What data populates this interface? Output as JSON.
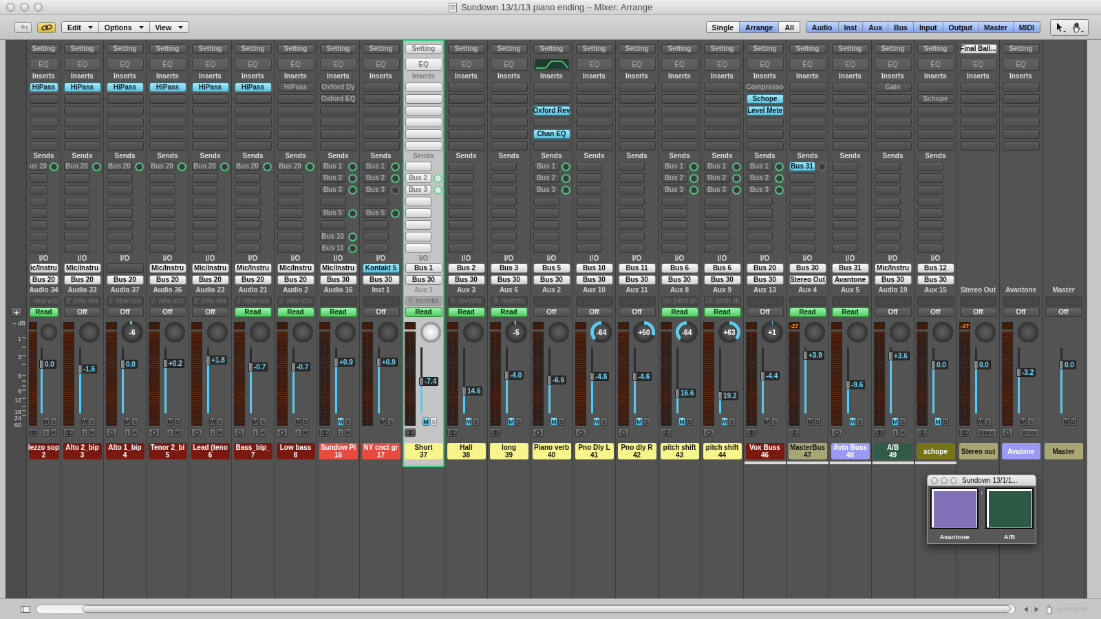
{
  "window": {
    "title": "Sundown 13/1/13 piano ending – Mixer: Arrange"
  },
  "toolbar": {
    "link": {
      "on": true
    },
    "menus": [
      "Edit",
      "Options",
      "View"
    ],
    "views": [
      {
        "label": "Single",
        "selected": false
      },
      {
        "label": "Arrange",
        "selected": true
      },
      {
        "label": "All",
        "selected": false
      }
    ],
    "filters": [
      {
        "label": "Audio",
        "selected": true
      },
      {
        "label": "Inst",
        "selected": true
      },
      {
        "label": "Aux",
        "selected": true
      },
      {
        "label": "Bus",
        "selected": true
      },
      {
        "label": "Input",
        "selected": true
      },
      {
        "label": "Output",
        "selected": true
      },
      {
        "label": "Master",
        "selected": true
      },
      {
        "label": "MIDI",
        "selected": true
      }
    ]
  },
  "scale": {
    "add_button": "+",
    "label": "– dB",
    "ticks": [
      "1",
      "3",
      "6",
      "9",
      "12",
      "18",
      "24",
      "60"
    ]
  },
  "strips": [
    {
      "kind": "channel",
      "selected": false,
      "setting": {
        "label": "Setting",
        "loaded": false
      },
      "eq": "EQ",
      "inserts_label": "Inserts",
      "inserts": [
        {
          "kind": "plugin",
          "label": "HiPass",
          "on": true
        }
      ],
      "sends_label": "Sends",
      "sends": [
        {
          "kind": "bus",
          "label": "us 20",
          "on": false,
          "active": true
        }
      ],
      "io_label": "I/O",
      "input": {
        "kind": "port",
        "label": "ic/Instru"
      },
      "output": "Bus 20",
      "track": "Audio 34",
      "group": ": new vox",
      "automation": {
        "label": "Read",
        "on": true
      },
      "meter": {
        "kind": "mono"
      },
      "fader": {
        "value": "0.0",
        "level": 0.75
      },
      "mute": {
        "label": "M",
        "on": false
      },
      "solo": {
        "label": "S"
      },
      "format": {
        "kind": "stereo"
      },
      "io_buttons": [
        "I",
        "R"
      ],
      "name": "lezzo sop",
      "number": "2",
      "color": "#7a1912",
      "underlined": false
    },
    {
      "kind": "channel",
      "selected": false,
      "setting": {
        "label": "Setting",
        "loaded": false
      },
      "eq": "EQ",
      "inserts_label": "Inserts",
      "inserts": [
        {
          "kind": "plugin",
          "label": "HiPass",
          "on": true
        }
      ],
      "sends_label": "Sends",
      "sends": [
        {
          "kind": "bus",
          "label": "Bus 20",
          "on": false,
          "active": true
        }
      ],
      "io_label": "I/O",
      "input": {
        "kind": "port",
        "label": "Mic/Instru"
      },
      "output": "Bus 20",
      "track": "Audio 33",
      "group": "2: new vox",
      "automation": {
        "label": "Off",
        "on": false
      },
      "meter": {
        "kind": "mono"
      },
      "fader": {
        "value": "-1.6",
        "level": 0.68
      },
      "mute": {
        "label": "M",
        "on": false
      },
      "solo": {
        "label": "S"
      },
      "format": {
        "kind": "stereo"
      },
      "io_buttons": [
        "I",
        "R"
      ],
      "name": "Alto 2_bip",
      "number": "3",
      "color": "#7a1912",
      "underlined": false
    },
    {
      "kind": "channel",
      "selected": false,
      "setting": {
        "label": "Setting",
        "loaded": false
      },
      "eq": "EQ",
      "inserts_label": "Inserts",
      "inserts": [
        {
          "kind": "plugin",
          "label": "HiPass",
          "on": true
        }
      ],
      "sends_label": "Sends",
      "sends": [
        {
          "kind": "bus",
          "label": "Bus 20",
          "on": false,
          "active": true
        }
      ],
      "io_label": "I/O",
      "input": {
        "kind": "empty"
      },
      "output": "Bus 20",
      "track": "Audio 37",
      "group": "2: new vox",
      "automation": {
        "label": "Off",
        "on": false
      },
      "pan": "-6",
      "meter": {
        "kind": "mono"
      },
      "fader": {
        "value": "0.0",
        "level": 0.75
      },
      "mute": {
        "label": "M",
        "on": false
      },
      "solo": {
        "label": "S"
      },
      "format": {
        "kind": "mono"
      },
      "io_buttons": [
        "I",
        "R"
      ],
      "name": "Alto 1_bip",
      "number": "4",
      "color": "#7a1912",
      "underlined": false
    },
    {
      "kind": "channel",
      "selected": false,
      "setting": {
        "label": "Setting",
        "loaded": false
      },
      "eq": "EQ",
      "inserts_label": "Inserts",
      "inserts": [
        {
          "kind": "plugin",
          "label": "HiPass",
          "on": true
        }
      ],
      "sends_label": "Sends",
      "sends": [
        {
          "kind": "bus",
          "label": "Bus 20",
          "on": false,
          "active": true
        }
      ],
      "io_label": "I/O",
      "input": {
        "kind": "port",
        "label": "Mic/Instru"
      },
      "output": "Bus 20",
      "track": "Audio 36",
      "group": "2: new vox",
      "automation": {
        "label": "Off",
        "on": false
      },
      "meter": {
        "kind": "mono"
      },
      "fader": {
        "value": "+0.2",
        "level": 0.76
      },
      "mute": {
        "label": "M",
        "on": false
      },
      "solo": {
        "label": "S"
      },
      "format": {
        "kind": "mono"
      },
      "io_buttons": [
        "I",
        "R"
      ],
      "name": "Tenor 2_bi",
      "number": "5",
      "color": "#7a1912",
      "underlined": false
    },
    {
      "kind": "channel",
      "selected": false,
      "setting": {
        "label": "Setting",
        "loaded": false
      },
      "eq": "EQ",
      "inserts_label": "Inserts",
      "inserts": [
        {
          "kind": "plugin",
          "label": "HiPass",
          "on": true
        }
      ],
      "sends_label": "Sends",
      "sends": [
        {
          "kind": "bus",
          "label": "Bus 20",
          "on": false,
          "active": true
        }
      ],
      "io_label": "I/O",
      "input": {
        "kind": "port",
        "label": "Mic/Instru"
      },
      "output": "Bus 20",
      "track": "Audio 23",
      "group": "2: new vox",
      "automation": {
        "label": "Off",
        "on": false
      },
      "meter": {
        "kind": "mono"
      },
      "fader": {
        "value": "+1.8",
        "level": 0.81
      },
      "mute": {
        "label": "M",
        "on": false
      },
      "solo": {
        "label": "S"
      },
      "format": {
        "kind": "mono"
      },
      "io_buttons": [
        "I",
        "R"
      ],
      "name": "Lead (teno",
      "number": "6",
      "color": "#7a1912",
      "underlined": false
    },
    {
      "kind": "channel",
      "selected": false,
      "setting": {
        "label": "Setting",
        "loaded": false
      },
      "eq": "EQ",
      "inserts_label": "Inserts",
      "inserts": [
        {
          "kind": "plugin",
          "label": "HiPass",
          "on": true
        }
      ],
      "sends_label": "Sends",
      "sends": [
        {
          "kind": "bus",
          "label": "Bus 20",
          "on": false,
          "active": true
        }
      ],
      "io_label": "I/O",
      "input": {
        "kind": "port",
        "label": "Mic/Instru"
      },
      "output": "Bus 20",
      "track": "Audio 21",
      "group": "2: new vox",
      "automation": {
        "label": "Read",
        "on": true
      },
      "meter": {
        "kind": "mono"
      },
      "fader": {
        "value": "-0.7",
        "level": 0.71
      },
      "mute": {
        "label": "M",
        "on": false
      },
      "solo": {
        "label": "S"
      },
      "format": {
        "kind": "mono"
      },
      "io_buttons": [
        "I",
        "R"
      ],
      "name": "Bass_bip_",
      "number": "7",
      "color": "#7a1912",
      "underlined": false
    },
    {
      "kind": "channel",
      "selected": false,
      "setting": {
        "label": "Setting",
        "loaded": false
      },
      "eq": "EQ",
      "inserts_label": "Inserts",
      "inserts": [
        {
          "kind": "plugin",
          "label": "HiPass",
          "on": false
        }
      ],
      "sends_label": "Sends",
      "sends": [
        {
          "kind": "bus",
          "label": "Bus 20",
          "on": false,
          "active": true
        }
      ],
      "io_label": "I/O",
      "input": {
        "kind": "port",
        "label": "Mic/Instru"
      },
      "output": "Bus 20",
      "track": "Audio 2",
      "group": "2: new vox",
      "automation": {
        "label": "Read",
        "on": true
      },
      "meter": {
        "kind": "mono"
      },
      "fader": {
        "value": "-0.7",
        "level": 0.71
      },
      "mute": {
        "label": "M",
        "on": false
      },
      "solo": {
        "label": "S"
      },
      "format": {
        "kind": "mono"
      },
      "io_buttons": [
        "I",
        "R"
      ],
      "name": "Low bass",
      "number": "8",
      "color": "#7a1912",
      "underlined": false
    },
    {
      "kind": "channel",
      "selected": false,
      "setting": {
        "label": "Setting",
        "loaded": false
      },
      "eq": "EQ",
      "inserts_label": "Inserts",
      "inserts": [
        {
          "kind": "plugin",
          "label": "Oxford Dy",
          "on": false
        },
        {
          "kind": "plugin",
          "label": "Oxford EQ",
          "on": false
        }
      ],
      "sends_label": "Sends",
      "sends": [
        {
          "kind": "bus",
          "label": "Bus 1",
          "on": false,
          "active": true
        },
        {
          "kind": "bus",
          "label": "Bus 2",
          "on": false,
          "active": true
        },
        {
          "kind": "bus",
          "label": "Bus 3",
          "on": false,
          "active": true
        },
        {
          "kind": "empty"
        },
        {
          "kind": "bus",
          "label": "Bus 5",
          "on": false,
          "active": true
        },
        {
          "kind": "empty"
        },
        {
          "kind": "bus",
          "label": "Bus 10",
          "on": false,
          "active": true
        },
        {
          "kind": "bus",
          "label": "Bus 11",
          "on": false,
          "active": true
        }
      ],
      "io_label": "I/O",
      "input": {
        "kind": "port",
        "label": "Mic/Instru"
      },
      "output": "Bus 30",
      "track": "Audio 16",
      "automation": {
        "label": "Read",
        "on": true
      },
      "meter": {
        "kind": "stereo"
      },
      "fader": {
        "value": "+0.9",
        "level": 0.78
      },
      "mute": {
        "label": "M",
        "on": true
      },
      "solo": {
        "label": "S"
      },
      "format": {
        "kind": "stereo"
      },
      "io_buttons": [
        "I",
        "R"
      ],
      "name": "Sundow Pi",
      "number": "16",
      "color": "#e84a3f",
      "underlined": false
    },
    {
      "kind": "channel",
      "selected": false,
      "setting": {
        "label": "Setting",
        "loaded": false
      },
      "eq": "EQ",
      "inserts_label": "Inserts",
      "sends_label": "Sends",
      "sends": [
        {
          "kind": "bus",
          "label": "Bus 1",
          "on": false,
          "active": true
        },
        {
          "kind": "bus",
          "label": "Bus 2",
          "on": false,
          "active": true
        },
        {
          "kind": "bus",
          "label": "Bus 3",
          "on": false,
          "active": false
        },
        {
          "kind": "empty"
        },
        {
          "kind": "bus",
          "label": "Bus 5",
          "on": false,
          "active": true
        }
      ],
      "io_label": "I/O",
      "input": {
        "kind": "plugin",
        "label": "Kontakt 5"
      },
      "output": "Bus 30",
      "track": "Inst 1",
      "automation": {
        "label": "Off",
        "on": false
      },
      "meter": {
        "kind": "stereo"
      },
      "fader": {
        "value": "+0.9",
        "level": 0.78
      },
      "mute": {
        "label": "M",
        "on": false
      },
      "solo": {
        "label": "S"
      },
      "name": "NY cnct gr",
      "number": "17",
      "color": "#e84a3f",
      "underlined": false
    },
    {
      "kind": "channel",
      "selected": true,
      "setting": {
        "label": "Setting",
        "loaded": false
      },
      "eq": "EQ",
      "inserts_label": "Inserts",
      "sends_label": "Sends",
      "sends": [
        {
          "kind": "empty"
        },
        {
          "kind": "bus",
          "label": "Bus 2",
          "on": false,
          "active": true
        },
        {
          "kind": "bus",
          "label": "Bus 3",
          "on": false,
          "active": true
        }
      ],
      "io_label": "I/O",
      "input": {
        "kind": "port",
        "label": "Bus 1"
      },
      "output": "Bus 30",
      "track": "Aux 1",
      "group": "9: reverbs",
      "automation": {
        "label": "Read",
        "on": true
      },
      "meter": {
        "kind": "stereo"
      },
      "fader": {
        "value": "-7.4",
        "level": 0.49
      },
      "mute": {
        "label": "M",
        "on": true
      },
      "solo": {
        "label": "S"
      },
      "format": {
        "kind": "stereo"
      },
      "name": "Short",
      "number": "37",
      "color": "#f8f48c",
      "underlined": false
    },
    {
      "kind": "channel",
      "selected": false,
      "setting": {
        "label": "Setting",
        "loaded": false
      },
      "eq": "EQ",
      "inserts_label": "Inserts",
      "sends_label": "Sends",
      "io_label": "I/O",
      "input": {
        "kind": "port",
        "label": "Bus 2"
      },
      "output": "Bus 30",
      "track": "Aux 3",
      "group": "9: reverbs",
      "automation": {
        "label": "Read",
        "on": true
      },
      "meter": {
        "kind": "stereo"
      },
      "fader": {
        "value": "14.6",
        "level": 0.34
      },
      "mute": {
        "label": "M",
        "on": true
      },
      "solo": {
        "label": "S"
      },
      "format": {
        "kind": "stereo"
      },
      "name": "Hall",
      "number": "38",
      "color": "#f8f48c",
      "underlined": false
    },
    {
      "kind": "channel",
      "selected": false,
      "setting": {
        "label": "Setting",
        "loaded": false
      },
      "eq": "EQ",
      "inserts_label": "Inserts",
      "sends_label": "Sends",
      "io_label": "I/O",
      "input": {
        "kind": "port",
        "label": "Bus 3"
      },
      "output": "Bus 30",
      "track": "Aux 6",
      "group": "9: reverbs",
      "automation": {
        "label": "Read",
        "on": true
      },
      "pan": "-5",
      "meter": {
        "kind": "stereo"
      },
      "fader": {
        "value": "-4.0",
        "level": 0.58
      },
      "mute": {
        "label": "M",
        "on": true
      },
      "solo": {
        "label": "S"
      },
      "format": {
        "kind": "stereo"
      },
      "name": "long",
      "number": "39",
      "color": "#f8f48c",
      "underlined": false
    },
    {
      "kind": "channel",
      "selected": false,
      "setting": {
        "label": "Setting",
        "loaded": false
      },
      "eq_curve": true,
      "inserts_label": "Inserts",
      "inserts": [
        {
          "kind": "empty"
        },
        {
          "kind": "empty"
        },
        {
          "kind": "plugin",
          "label": "Oxford Rev",
          "on": true
        },
        {
          "kind": "empty"
        },
        {
          "kind": "plugin",
          "label": "Chan EQ",
          "on": true
        }
      ],
      "sends_label": "Sends",
      "sends": [
        {
          "kind": "bus",
          "label": "Bus 1",
          "on": false,
          "active": true
        },
        {
          "kind": "bus",
          "label": "Bus 2",
          "on": false,
          "active": true
        },
        {
          "kind": "bus",
          "label": "Bus 3",
          "on": false,
          "active": true
        }
      ],
      "io_label": "I/O",
      "input": {
        "kind": "port",
        "label": "Bus 5"
      },
      "output": "Bus 30",
      "track": "Aux 2",
      "automation": {
        "label": "Off",
        "on": false
      },
      "meter": {
        "kind": "stereo"
      },
      "fader": {
        "value": "-6.6",
        "level": 0.51
      },
      "mute": {
        "label": "M",
        "on": true
      },
      "solo": {
        "label": "S"
      },
      "format": {
        "kind": "mono"
      },
      "name": "Piano verb",
      "number": "40",
      "color": "#f8f48c",
      "underlined": false
    },
    {
      "kind": "channel",
      "selected": false,
      "setting": {
        "label": "Setting",
        "loaded": false
      },
      "eq": "EQ",
      "inserts_label": "Inserts",
      "sends_label": "Sends",
      "io_label": "I/O",
      "input": {
        "kind": "port",
        "label": "Bus 10"
      },
      "output": "Bus 30",
      "track": "Aux 10",
      "automation": {
        "label": "Off",
        "on": false
      },
      "pan": "-64",
      "meter": {
        "kind": "mono"
      },
      "fader": {
        "value": "-4.6",
        "level": 0.56
      },
      "mute": {
        "label": "M",
        "on": true
      },
      "solo": {
        "label": "S"
      },
      "format": {
        "kind": "mono"
      },
      "name": "Pno Dly L",
      "number": "41",
      "color": "#f8f48c",
      "underlined": false
    },
    {
      "kind": "channel",
      "selected": false,
      "setting": {
        "label": "Setting",
        "loaded": false
      },
      "eq": "EQ",
      "inserts_label": "Inserts",
      "sends_label": "Sends",
      "io_label": "I/O",
      "input": {
        "kind": "port",
        "label": "Bus 11"
      },
      "output": "Bus 30",
      "track": "Aux 11",
      "automation": {
        "label": "Off",
        "on": false
      },
      "pan": "+50",
      "meter": {
        "kind": "mono"
      },
      "fader": {
        "value": "-4.6",
        "level": 0.56
      },
      "mute": {
        "label": "M",
        "on": true
      },
      "solo": {
        "label": "S"
      },
      "format": {
        "kind": "mono"
      },
      "name": "Pno dly R",
      "number": "42",
      "color": "#f8f48c",
      "underlined": false
    },
    {
      "kind": "channel",
      "selected": false,
      "setting": {
        "label": "Setting",
        "loaded": false
      },
      "eq": "EQ",
      "inserts_label": "Inserts",
      "sends_label": "Sends",
      "sends": [
        {
          "kind": "bus",
          "label": "Bus 1",
          "on": false,
          "active": true
        },
        {
          "kind": "bus",
          "label": "Bus 2",
          "on": false,
          "active": true
        },
        {
          "kind": "bus",
          "label": "Bus 3",
          "on": false,
          "active": true
        }
      ],
      "io_label": "I/O",
      "input": {
        "kind": "port",
        "label": "Bus 6"
      },
      "output": "Bus 30",
      "track": "Aux 8",
      "group": "10: pitch sh",
      "automation": {
        "label": "Read",
        "on": true
      },
      "pan": "-64",
      "meter": {
        "kind": "stereo"
      },
      "fader": {
        "value": "16.6",
        "level": 0.31
      },
      "mute": {
        "label": "M",
        "on": true
      },
      "solo": {
        "label": "S"
      },
      "format": {
        "kind": "stereo"
      },
      "name": "pitch shift",
      "number": "43",
      "color": "#f8f48c",
      "underlined": false
    },
    {
      "kind": "channel",
      "selected": false,
      "setting": {
        "label": "Setting",
        "loaded": false
      },
      "eq": "EQ",
      "inserts_label": "Inserts",
      "sends_label": "Sends",
      "sends": [
        {
          "kind": "bus",
          "label": "Bus 1",
          "on": false,
          "active": true
        },
        {
          "kind": "bus",
          "label": "Bus 2",
          "on": false,
          "active": true
        },
        {
          "kind": "bus",
          "label": "Bus 3",
          "on": false,
          "active": true
        }
      ],
      "io_label": "I/O",
      "input": {
        "kind": "port",
        "label": "Bus 6"
      },
      "output": "Bus 30",
      "track": "Aux 9",
      "group": "10: pitch sh",
      "automation": {
        "label": "Read",
        "on": true
      },
      "pan": "+63",
      "meter": {
        "kind": "mono"
      },
      "fader": {
        "value": "19.2",
        "level": 0.27
      },
      "mute": {
        "label": "M",
        "on": true
      },
      "solo": {
        "label": "S"
      },
      "format": {
        "kind": "mono"
      },
      "name": "pitch shift",
      "number": "44",
      "color": "#f8f48c",
      "underlined": false
    },
    {
      "kind": "channel",
      "selected": false,
      "setting": {
        "label": "Setting",
        "loaded": false
      },
      "eq": "EQ",
      "inserts_label": "Inserts",
      "inserts": [
        {
          "kind": "plugin",
          "label": "Compresso",
          "on": false
        },
        {
          "kind": "plugin",
          "label": "Schope",
          "on": true
        },
        {
          "kind": "plugin",
          "label": "Level Mete",
          "on": true
        }
      ],
      "sends_label": "Sends",
      "sends": [
        {
          "kind": "bus",
          "label": "Bus 1",
          "on": false,
          "active": true
        },
        {
          "kind": "bus",
          "label": "Bus 2",
          "on": false,
          "active": true
        },
        {
          "kind": "bus",
          "label": "Bus 3",
          "on": false,
          "active": true
        }
      ],
      "io_label": "I/O",
      "input": {
        "kind": "port",
        "label": "Bus 20"
      },
      "output": "Bus 30",
      "track": "Aux 13",
      "automation": {
        "label": "Off",
        "on": false
      },
      "pan": "+1",
      "meter": {
        "kind": "stereo"
      },
      "fader": {
        "value": "-4.4",
        "level": 0.57
      },
      "mute": {
        "label": "M",
        "on": false
      },
      "solo": {
        "label": "S"
      },
      "format": {
        "kind": "stereo"
      },
      "name": "Vox Buss",
      "number": "46",
      "color": "#7a1912",
      "underlined": true
    },
    {
      "kind": "channel",
      "selected": false,
      "setting": {
        "label": "Setting",
        "loaded": false
      },
      "eq": "EQ",
      "inserts_label": "Inserts",
      "sends_label": "Sends",
      "sends": [
        {
          "kind": "bus",
          "label": "Bus 31",
          "on": true,
          "active": false
        }
      ],
      "io_label": "I/O",
      "input": {
        "kind": "port",
        "label": "Bus 30"
      },
      "output": "Stereo Out",
      "track": "Aux 4",
      "automation": {
        "label": "Read",
        "on": true
      },
      "peak": "-27",
      "meter": {
        "kind": "stereo"
      },
      "fader": {
        "value": "+3.9",
        "level": 0.89
      },
      "mute": {
        "label": "M",
        "on": false
      },
      "solo": {
        "label": "S"
      },
      "format": {
        "kind": "stereo"
      },
      "name": "MasterBus",
      "number": "47",
      "color": "#a9a676",
      "underlined": true
    },
    {
      "kind": "channel",
      "selected": false,
      "setting": {
        "label": "Setting",
        "loaded": false
      },
      "eq": "EQ",
      "inserts_label": "Inserts",
      "sends_label": "Sends",
      "io_label": "I/O",
      "input": {
        "kind": "port",
        "label": "Bus 31"
      },
      "output": "Avantone",
      "track": "Aux 5",
      "automation": {
        "label": "Read",
        "on": true
      },
      "meter": {
        "kind": "mono"
      },
      "fader": {
        "value": "-9.6",
        "level": 0.44
      },
      "mute": {
        "label": "M",
        "on": true
      },
      "solo": {
        "label": "S"
      },
      "format": {
        "kind": "mono"
      },
      "name": "Avtn Buss",
      "number": "48",
      "color": "#9a9af2",
      "underlined": true
    },
    {
      "kind": "channel",
      "selected": false,
      "setting": {
        "label": "Setting",
        "loaded": false
      },
      "eq": "EQ",
      "inserts_label": "Inserts",
      "inserts": [
        {
          "kind": "plugin",
          "label": "Gain",
          "on": false
        }
      ],
      "sends_label": "Sends",
      "io_label": "I/O",
      "input": {
        "kind": "port",
        "label": "Mic/Instru"
      },
      "output": "Bus 30",
      "track": "Audio 19",
      "automation": {
        "label": "Off",
        "on": false
      },
      "meter": {
        "kind": "stereo"
      },
      "fader": {
        "value": "+3.6",
        "level": 0.88
      },
      "mute": {
        "label": "M",
        "on": true
      },
      "solo": {
        "label": "S"
      },
      "format": {
        "kind": "stereo"
      },
      "io_buttons": [
        "I",
        "R"
      ],
      "name": "A/B",
      "number": "49",
      "color": "#2f5a47",
      "underlined": true
    },
    {
      "kind": "channel",
      "selected": false,
      "setting": {
        "label": "Setting",
        "loaded": false
      },
      "eq": "EQ",
      "inserts_label": "Inserts",
      "inserts": [
        {
          "kind": "empty"
        },
        {
          "kind": "plugin",
          "label": "Schope",
          "on": false
        }
      ],
      "sends_label": "Sends",
      "io_label": "I/O",
      "input": {
        "kind": "port",
        "label": "Bus 12"
      },
      "output": "Bus 30",
      "track": "Aux 15",
      "automation": {
        "label": "Off",
        "on": false
      },
      "meter": {
        "kind": "stereo"
      },
      "fader": {
        "value": "0.0",
        "level": 0.74
      },
      "mute": {
        "label": "M",
        "on": true
      },
      "solo": {
        "label": "S"
      },
      "format": {
        "kind": "stereo"
      },
      "name": "schope",
      "color": "#777318",
      "underlined": true
    },
    {
      "kind": "output",
      "selected": false,
      "setting": {
        "label": "Final Ball...",
        "loaded": true
      },
      "eq": "EQ",
      "inserts_label": "Inserts",
      "track": "Stereo Out",
      "automation": {
        "label": "Off",
        "on": false
      },
      "peak": "-27",
      "meter": {
        "kind": "stereo"
      },
      "fader": {
        "value": "0.0",
        "level": 0.74
      },
      "mute": {
        "label": "M",
        "on": false
      },
      "solo": {
        "label": "S"
      },
      "format": {
        "kind": "stereo"
      },
      "io_buttons": [
        "Bnce"
      ],
      "name": "Stereo out",
      "color": "#a9a676",
      "underlined": false
    },
    {
      "kind": "output",
      "selected": false,
      "setting": {
        "label": "Setting",
        "loaded": false
      },
      "eq": "EQ",
      "inserts_label": "Inserts",
      "track": "Avantone",
      "automation": {
        "label": "Off",
        "on": false
      },
      "meter": {
        "kind": "mono"
      },
      "fader": {
        "value": "-3.2",
        "level": 0.62
      },
      "mute": {
        "label": "M",
        "on": false
      },
      "solo": {
        "label": "S"
      },
      "format": {
        "kind": "mono"
      },
      "io_buttons": [
        "Bnce"
      ],
      "name": "Avatone",
      "color": "#9a9af2",
      "underlined": false
    },
    {
      "kind": "master",
      "selected": false,
      "track": "Master",
      "automation": {
        "label": "Off",
        "on": false
      },
      "fader": {
        "value": "0.0",
        "level": 0.74
      },
      "mute": {
        "label": "M",
        "on": false
      },
      "solo": {
        "label": "D"
      },
      "name": "Master",
      "color": "#a9a676",
      "underlined": false
    }
  ],
  "floating_window": {
    "title": "Sundown 13/1/1...",
    "pads": [
      {
        "label": "Avantone",
        "color": "#8270b8"
      },
      {
        "label": "A/B",
        "color": "#2c5a46"
      }
    ]
  }
}
